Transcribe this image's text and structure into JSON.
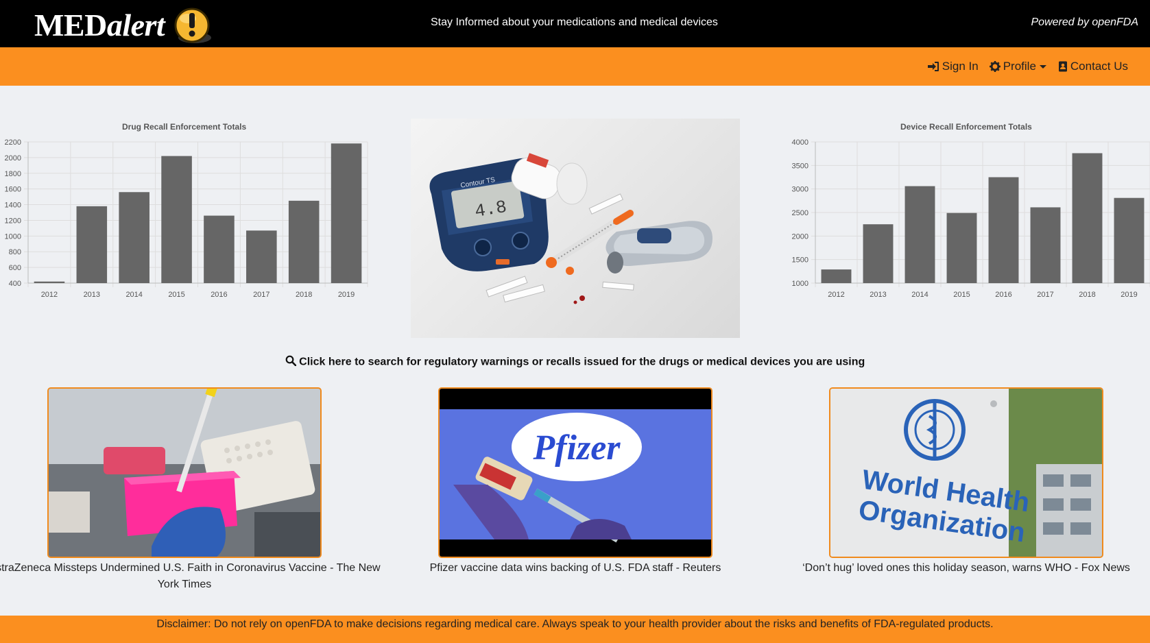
{
  "header": {
    "logo": {
      "text_main": "MED",
      "text_italic": "alert",
      "icon": "exclamation-warning-icon",
      "icon_color": "#f5b731"
    },
    "tagline": "Stay Informed about your medications and medical devices",
    "powered_by": "Powered by openFDA"
  },
  "nav": {
    "sign_in": {
      "label": "Sign In",
      "icon": "sign-in-icon"
    },
    "profile": {
      "label": "Profile",
      "icon": "gear-icon"
    },
    "contact": {
      "label": "Contact Us",
      "icon": "contact-book-icon"
    }
  },
  "chart_data": [
    {
      "type": "bar",
      "title": "Drug Recall Enforcement Totals",
      "categories": [
        "2012",
        "2013",
        "2014",
        "2015",
        "2016",
        "2017",
        "2018",
        "2019"
      ],
      "values": [
        420,
        1380,
        1560,
        2020,
        1260,
        1070,
        1450,
        2180
      ],
      "ylim": [
        400,
        2200
      ],
      "yticks": [
        400,
        600,
        800,
        1000,
        1200,
        1400,
        1600,
        1800,
        2000,
        2200
      ],
      "grid": true,
      "bar_color": "#666666"
    },
    {
      "type": "bar",
      "title": "Device Recall Enforcement Totals",
      "categories": [
        "2012",
        "2013",
        "2014",
        "2015",
        "2016",
        "2017",
        "2018",
        "2019"
      ],
      "values": [
        1290,
        2250,
        3060,
        2490,
        3250,
        2610,
        3760,
        2810
      ],
      "ylim": [
        1000,
        4000
      ],
      "yticks": [
        1000,
        1500,
        2000,
        2500,
        3000,
        3500,
        4000
      ],
      "grid": true,
      "bar_color": "#666666"
    }
  ],
  "search": {
    "icon": "search-icon",
    "label": "Click here to search for regulatory warnings or recalls issued for the drugs or medical devices you are using"
  },
  "news": [
    {
      "caption": "AstraZeneca Missteps Undermined U.S. Faith in Coronavirus Vaccine - The New York Times"
    },
    {
      "caption": "Pfizer vaccine data wins backing of U.S. FDA staff - Reuters"
    },
    {
      "caption": "‘Don’t hug’ loved ones this holiday season, warns WHO - Fox News"
    }
  ],
  "hero_image": {
    "meter_reading": "4.8",
    "meter_brand": "Contour TS"
  },
  "news_image_text": {
    "pfizer_logo": "Pfizer",
    "who_sign_line1": "World Health",
    "who_sign_line2": "Organization"
  },
  "footer": {
    "disclaimer": "Disclaimer: Do not rely on openFDA to make decisions regarding medical care. Always speak to your health provider about the risks and benefits of FDA-regulated products."
  },
  "colors": {
    "accent": "#fb8f1f",
    "header_bg": "#000000",
    "page_bg": "#eef0f3"
  }
}
